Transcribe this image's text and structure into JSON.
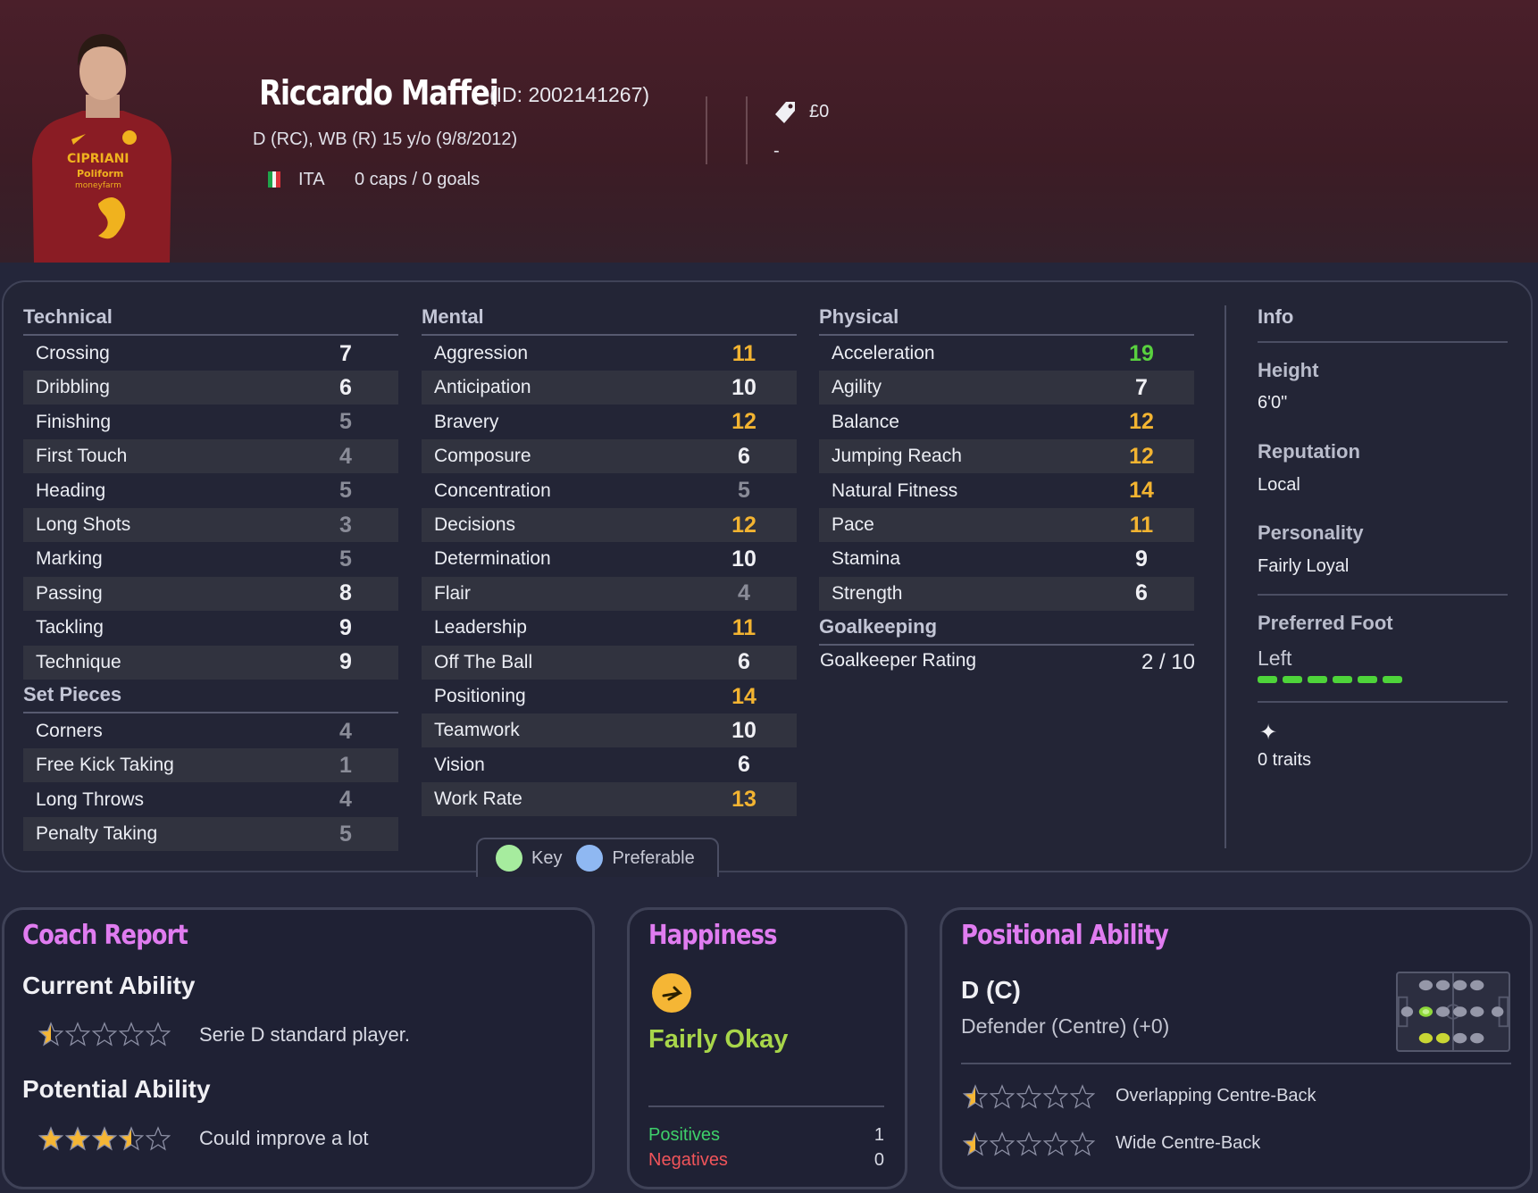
{
  "player": {
    "name": "Riccardo Maffei",
    "id": "(ID: 2002141267)",
    "positions": "D (RC), WB (R)",
    "age": "15 y/o (9/8/2012)",
    "nationality": "ITA",
    "caps": "0 caps / 0 goals",
    "value": "£0",
    "contract": "-",
    "shirt_sponsor": [
      "CIPRIANI",
      "Poliform",
      "moneyfarm"
    ]
  },
  "colors": {
    "accent_title": "#e07cf0",
    "good": "#f3b431",
    "great": "#59d13f",
    "low": "#8a8c98"
  },
  "technical": {
    "title": "Technical",
    "items": [
      {
        "label": "Crossing",
        "value": "7"
      },
      {
        "label": "Dribbling",
        "value": "6"
      },
      {
        "label": "Finishing",
        "value": "5"
      },
      {
        "label": "First Touch",
        "value": "4"
      },
      {
        "label": "Heading",
        "value": "5"
      },
      {
        "label": "Long Shots",
        "value": "3"
      },
      {
        "label": "Marking",
        "value": "5"
      },
      {
        "label": "Passing",
        "value": "8"
      },
      {
        "label": "Tackling",
        "value": "9"
      },
      {
        "label": "Technique",
        "value": "9"
      }
    ]
  },
  "set_pieces": {
    "title": "Set Pieces",
    "items": [
      {
        "label": "Corners",
        "value": "4"
      },
      {
        "label": "Free Kick Taking",
        "value": "1"
      },
      {
        "label": "Long Throws",
        "value": "4"
      },
      {
        "label": "Penalty Taking",
        "value": "5"
      }
    ]
  },
  "mental": {
    "title": "Mental",
    "items": [
      {
        "label": "Aggression",
        "value": "11"
      },
      {
        "label": "Anticipation",
        "value": "10"
      },
      {
        "label": "Bravery",
        "value": "12"
      },
      {
        "label": "Composure",
        "value": "6"
      },
      {
        "label": "Concentration",
        "value": "5"
      },
      {
        "label": "Decisions",
        "value": "12"
      },
      {
        "label": "Determination",
        "value": "10"
      },
      {
        "label": "Flair",
        "value": "4"
      },
      {
        "label": "Leadership",
        "value": "11"
      },
      {
        "label": "Off The Ball",
        "value": "6"
      },
      {
        "label": "Positioning",
        "value": "14"
      },
      {
        "label": "Teamwork",
        "value": "10"
      },
      {
        "label": "Vision",
        "value": "6"
      },
      {
        "label": "Work Rate",
        "value": "13"
      }
    ]
  },
  "physical": {
    "title": "Physical",
    "items": [
      {
        "label": "Acceleration",
        "value": "19"
      },
      {
        "label": "Agility",
        "value": "7"
      },
      {
        "label": "Balance",
        "value": "12"
      },
      {
        "label": "Jumping Reach",
        "value": "12"
      },
      {
        "label": "Natural Fitness",
        "value": "14"
      },
      {
        "label": "Pace",
        "value": "11"
      },
      {
        "label": "Stamina",
        "value": "9"
      },
      {
        "label": "Strength",
        "value": "6"
      }
    ]
  },
  "goalkeeping": {
    "title": "Goalkeeping",
    "label": "Goalkeeper Rating",
    "value": "2 / 10"
  },
  "info": {
    "title": "Info",
    "height_label": "Height",
    "height": "6'0\"",
    "reputation_label": "Reputation",
    "reputation": "Local",
    "personality_label": "Personality",
    "personality": "Fairly Loyal",
    "foot_label": "Preferred Foot",
    "foot": "Left",
    "foot_strength": 1.0,
    "traits": "0 traits"
  },
  "key": {
    "key_label": "Key",
    "preferable_label": "Preferable",
    "key_color": "#a6ec9e",
    "preferable_color": "#8fb8f2"
  },
  "coach_report": {
    "title": "Coach Report",
    "current_label": "Current Ability",
    "current_stars": 0.5,
    "current_text": "Serie D standard player.",
    "potential_label": "Potential Ability",
    "potential_stars": 3.5,
    "potential_text": "Could improve a lot"
  },
  "happiness": {
    "title": "Happiness",
    "status": "Fairly Okay",
    "positives_label": "Positives",
    "positives": "1",
    "negatives_label": "Negatives",
    "negatives": "0"
  },
  "positional": {
    "title": "Positional Ability",
    "position": "D (C)",
    "description": "Defender (Centre) (+0)",
    "roles": [
      {
        "label": "Overlapping Centre-Back",
        "stars": 0.5
      },
      {
        "label": "Wide Centre-Back",
        "stars": 0.5
      }
    ]
  }
}
